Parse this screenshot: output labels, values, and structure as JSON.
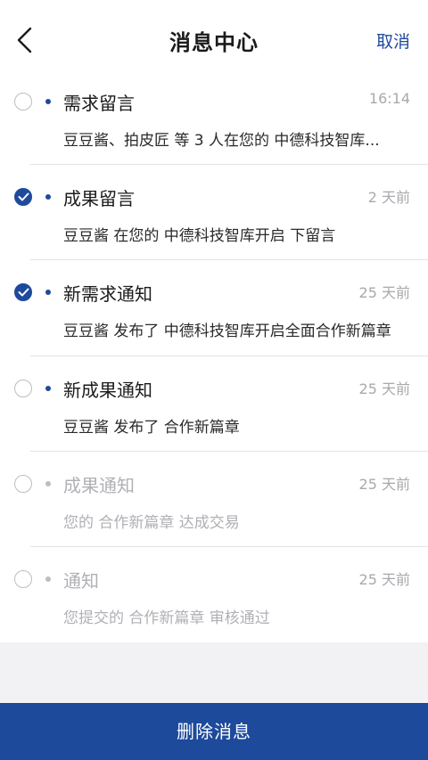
{
  "header": {
    "title": "消息中心",
    "cancel_label": "取消"
  },
  "messages": [
    {
      "title": "需求留言",
      "time": "16:14",
      "body": "豆豆酱、拍皮匠 等 3 人在您的 中德科技智库...",
      "checked": false,
      "read": false
    },
    {
      "title": "成果留言",
      "time": "2 天前",
      "body": "豆豆酱 在您的 中德科技智库开启 下留言",
      "checked": true,
      "read": false
    },
    {
      "title": "新需求通知",
      "time": "25 天前",
      "body": "豆豆酱 发布了 中德科技智库开启全面合作新篇章",
      "checked": true,
      "read": false
    },
    {
      "title": "新成果通知",
      "time": "25 天前",
      "body": "豆豆酱 发布了 合作新篇章",
      "checked": false,
      "read": false
    },
    {
      "title": "成果通知",
      "time": "25 天前",
      "body": "您的 合作新篇章 达成交易",
      "checked": false,
      "read": true
    },
    {
      "title": "通知",
      "time": "25 天前",
      "body": "您提交的 合作新篇章 审核通过",
      "checked": false,
      "read": true
    }
  ],
  "footer": {
    "delete_label": "删除消息"
  },
  "colors": {
    "accent": "#1e4a9c",
    "unread_dot": "#1e4a9c",
    "read_text": "#b0b0b5"
  }
}
